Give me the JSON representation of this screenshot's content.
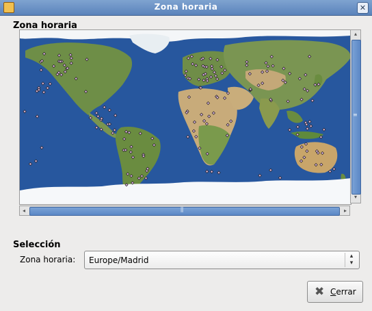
{
  "window": {
    "title": "Zona horaria",
    "close_glyph": "✕",
    "icon": "app-icon"
  },
  "map_section": {
    "title": "Zona horaria"
  },
  "scrollbars": {
    "up": "▴",
    "down": "▾",
    "left": "◂",
    "right": "▸",
    "grip_v": "≡",
    "grip_h": "⫼"
  },
  "selection": {
    "title": "Selección",
    "timezone_label": "Zona horaria:",
    "timezone_value": "Europe/Madrid"
  },
  "buttons": {
    "close_label": "Cerrar",
    "close_icon": "✖"
  },
  "colors": {
    "ocean": "#27579e",
    "land": "#6e8e47",
    "desert": "#c8ab7a",
    "ice": "#ffffff",
    "marker": "#d8b0d8"
  }
}
